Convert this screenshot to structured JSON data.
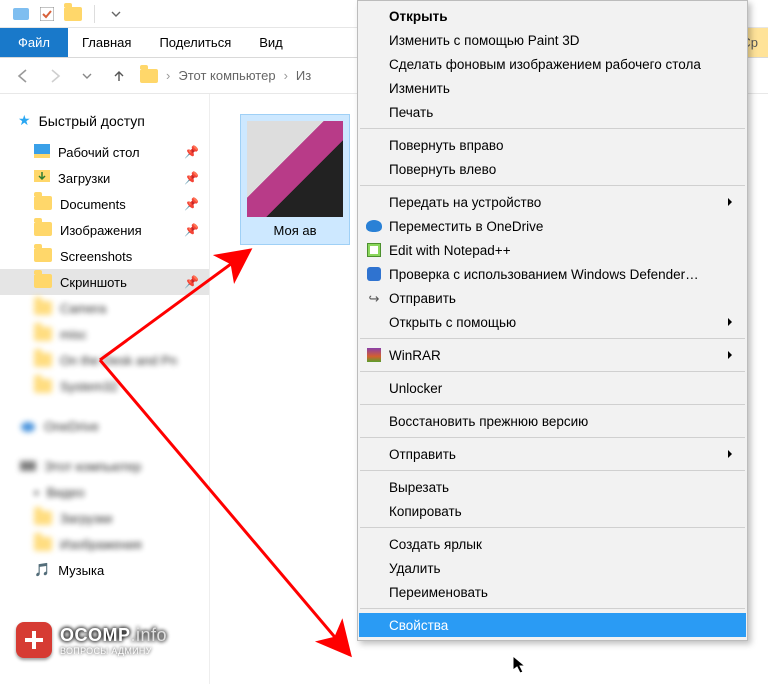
{
  "titlebar": {
    "qat_icons": [
      "app-icon",
      "checkbox-icon",
      "folder-icon",
      "chevron-down-icon",
      "divider"
    ]
  },
  "ribbon": {
    "file": "Файл",
    "tabs": [
      "Главная",
      "Поделиться",
      "Вид"
    ],
    "tool_tab": "Ср"
  },
  "address": {
    "crumbs": [
      "Этот компьютер",
      "Из"
    ]
  },
  "sidebar": {
    "quick_access": "Быстрый доступ",
    "items": [
      {
        "label": "Рабочий стол",
        "icon": "desktop-icon",
        "pinned": true
      },
      {
        "label": "Загрузки",
        "icon": "downloads-icon",
        "pinned": true
      },
      {
        "label": "Documents",
        "icon": "documents-icon",
        "pinned": true
      },
      {
        "label": "Изображения",
        "icon": "pictures-icon",
        "pinned": true
      },
      {
        "label": "Screenshots",
        "icon": "folder-icon",
        "pinned": false
      },
      {
        "label": "Скриншоть",
        "icon": "folder-icon",
        "pinned": true,
        "selected": true
      }
    ],
    "music_label": "Музыка"
  },
  "content": {
    "thumb_caption": "Моя ав"
  },
  "context_menu": {
    "groups": [
      [
        {
          "label": "Открыть",
          "bold": true
        },
        {
          "label": "Изменить с помощью Paint 3D"
        },
        {
          "label": "Сделать фоновым изображением рабочего стола"
        },
        {
          "label": "Изменить"
        },
        {
          "label": "Печать"
        }
      ],
      [
        {
          "label": "Повернуть вправо"
        },
        {
          "label": "Повернуть влево"
        }
      ],
      [
        {
          "label": "Передать на устройство",
          "sub": true
        },
        {
          "label": "Переместить в OneDrive",
          "icon": "onedrive-icon"
        },
        {
          "label": "Edit with Notepad++",
          "icon": "notepad-icon"
        },
        {
          "label": "Проверка с использованием Windows Defender…",
          "icon": "shield-icon"
        },
        {
          "label": "Отправить",
          "icon": "share-icon"
        },
        {
          "label": "Открыть с помощью",
          "sub": true
        }
      ],
      [
        {
          "label": "WinRAR",
          "icon": "winrar-icon",
          "sub": true
        }
      ],
      [
        {
          "label": "Unlocker"
        }
      ],
      [
        {
          "label": "Восстановить прежнюю версию"
        }
      ],
      [
        {
          "label": "Отправить",
          "sub": true
        }
      ],
      [
        {
          "label": "Вырезать"
        },
        {
          "label": "Копировать"
        }
      ],
      [
        {
          "label": "Создать ярлык"
        },
        {
          "label": "Удалить"
        },
        {
          "label": "Переименовать"
        }
      ],
      [
        {
          "label": "Свойства",
          "highlight": true
        }
      ]
    ]
  },
  "watermark": {
    "brand": "OCOMP",
    "suffix": ".info",
    "tagline": "ВОПРОСЫ АДМИНУ"
  }
}
